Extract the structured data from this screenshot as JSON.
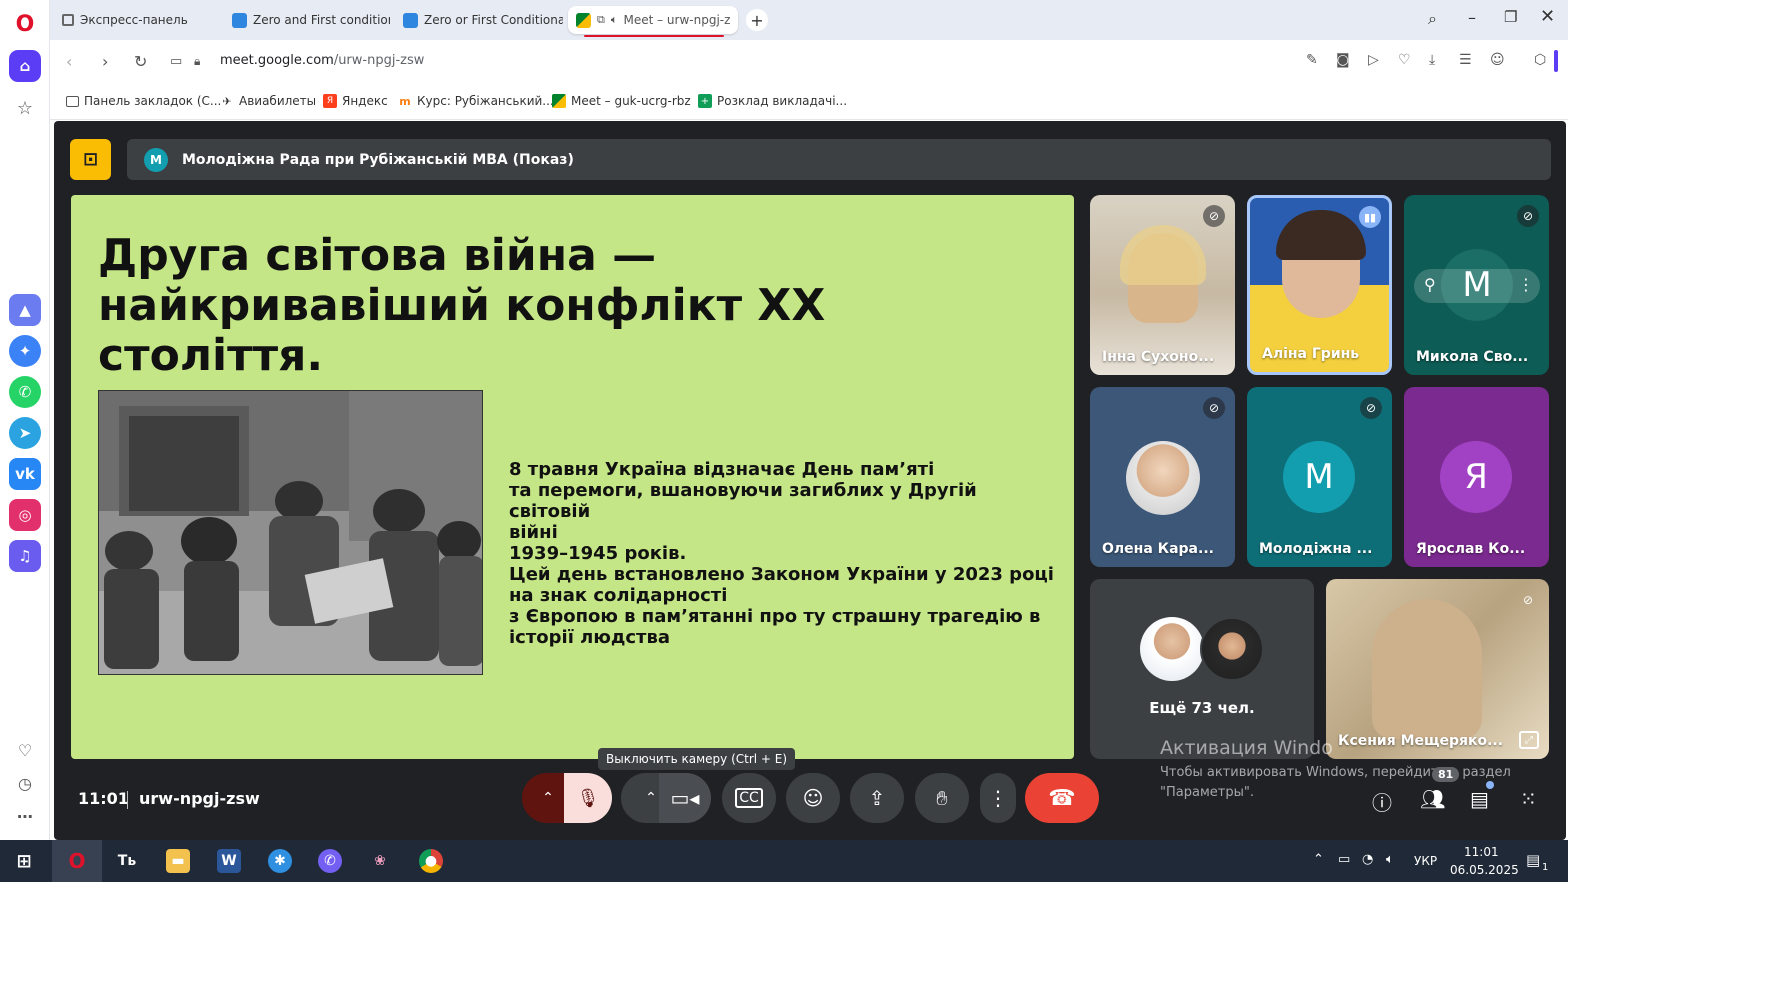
{
  "browser": {
    "tabs": [
      {
        "label": "Экспресс-панель"
      },
      {
        "label": "Zero and First conditional"
      },
      {
        "label": "Zero or First Conditional -"
      },
      {
        "label": "Meet – urw-npgj-z"
      }
    ],
    "url_host": "meet.google.com",
    "url_path": "/urw-npgj-zsw",
    "bookmarks": [
      {
        "label": "Панель закладок (С..."
      },
      {
        "label": "Авиабилеты"
      },
      {
        "label": "Яндекс"
      },
      {
        "label": "Курс: Рубіжанський..."
      },
      {
        "label": "Meet – guk-ucrg-rbz"
      },
      {
        "label": "Розклад викладачі..."
      }
    ]
  },
  "meet": {
    "presenter_initial": "M",
    "presentation_title": "Молодіжна Рада при Рубіжанській МВА (Показ)",
    "slide": {
      "title": "Друга світова війна — найкривавіший конфлікт XX століття.",
      "body_lines": [
        "8 травня Україна відзначає День пам’яті",
        "та перемоги, вшановуючи загиблих у Другій світовій",
        "війні",
        "1939–1945 років.",
        "Цей день встановлено Законом України у 2023 році",
        "на знак солідарності",
        "з Європою в пам’ятанні про ту страшну трагедію в",
        "історії людства"
      ]
    },
    "participants": [
      {
        "name": "Інна Сухоно..."
      },
      {
        "name": "Аліна Гринь"
      },
      {
        "name": "Микола Сво...",
        "initial": "M"
      },
      {
        "name": "Олена Кара..."
      },
      {
        "name": "Молодіжна ...",
        "initial": "M"
      },
      {
        "name": "Ярослав Ко...",
        "initial": "Я"
      },
      {
        "name": "Ксения Мещеряко..."
      }
    ],
    "more_participants": "Ещё 73 чел.",
    "time": "11:01",
    "meeting_code": "urw-npgj-zsw",
    "tooltip": "Выключить камеру (Ctrl + E)",
    "people_count": "81",
    "colors": {
      "slide_bg": "#c5e686",
      "meet_bg": "#202124",
      "end_call": "#ea4335",
      "mic_off_bg": "#f9dedc",
      "present_badge": "#fbbc04"
    }
  },
  "windows": {
    "activation_title": "Активация Windo",
    "activation_line1": "Чтобы активировать Windows, перейдите в раздел",
    "activation_line2": "\"Параметры\".",
    "language": "УКР",
    "clock_time": "11:01",
    "clock_date": "06.05.2025",
    "notifications": "1"
  }
}
